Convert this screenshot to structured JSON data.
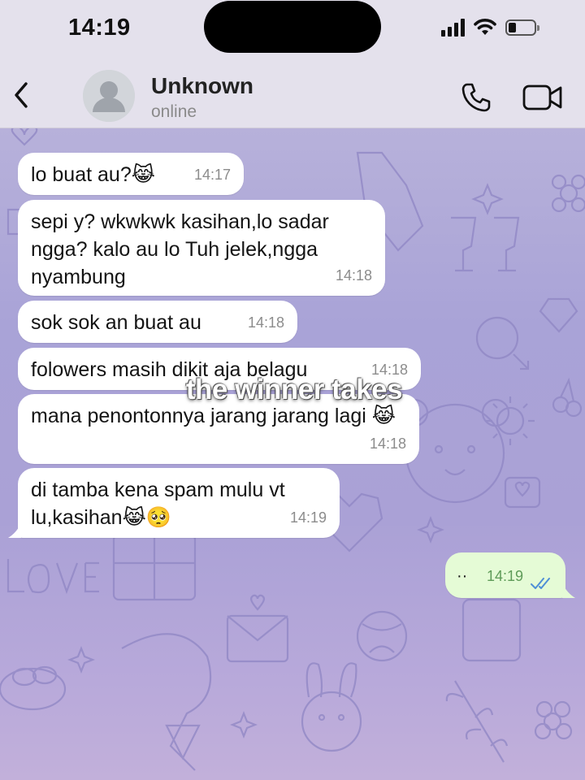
{
  "status_bar": {
    "time": "14:19",
    "icons": [
      "signal-icon",
      "wifi-icon",
      "battery-icon"
    ],
    "battery_level": 0.2
  },
  "header": {
    "contact_name": "Unknown",
    "contact_status": "online",
    "icons": [
      "back-chevron-icon",
      "avatar-placeholder-icon",
      "phone-icon",
      "video-camera-icon"
    ]
  },
  "messages": [
    {
      "direction": "incoming",
      "text": "lo buat au?😹",
      "time": "14:17"
    },
    {
      "direction": "incoming",
      "text": "sepi y? wkwkwk kasihan,lo sadar ngga? kalo au lo Tuh jelek,ngga nyambung",
      "time": "14:18"
    },
    {
      "direction": "incoming",
      "text": "sok sok an buat au",
      "time": "14:18"
    },
    {
      "direction": "incoming",
      "text": "folowers masih dikit aja belagu",
      "time": "14:18"
    },
    {
      "direction": "incoming",
      "text": "mana penontonnya jarang jarang lagi 😹",
      "time": "14:18"
    },
    {
      "direction": "incoming",
      "text": "di tamba kena spam mulu vt lu,kasihan😹🥺",
      "time": "14:19"
    },
    {
      "direction": "outgoing",
      "text": "··",
      "time": "14:19",
      "status": "read"
    }
  ],
  "overlay": {
    "caption": "the winner takes"
  },
  "colors": {
    "incoming_bubble": "#ffffff",
    "outgoing_bubble": "#e5fbd6",
    "read_check": "#4f8fd6",
    "wallpaper": "#aaa3d7"
  }
}
